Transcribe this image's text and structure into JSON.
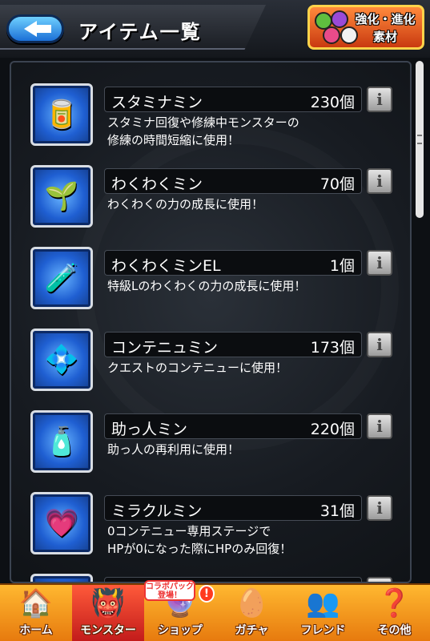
{
  "header": {
    "title": "アイテム一覧",
    "evolve_label_line1": "強化・進化",
    "evolve_label_line2": "素材"
  },
  "items": [
    {
      "name": "スタミナミン",
      "count": "230個",
      "desc1": "スタミナ回復や修練中モンスターの",
      "desc2": "修練の時間短縮に使用！",
      "icon": "stamina-can-icon"
    },
    {
      "name": "わくわくミン",
      "count": "70個",
      "desc1": "わくわくの力の成長に使用！",
      "desc2": "",
      "icon": "sprout-bottle-icon"
    },
    {
      "name": "わくわくミンEL",
      "count": "1個",
      "desc1": "特級Lのわくわくの力の成長に使用！",
      "desc2": "",
      "icon": "sprout-bottle-el-icon"
    },
    {
      "name": "コンテニュミン",
      "count": "173個",
      "desc1": "クエストのコンテニューに使用！",
      "desc2": "",
      "icon": "continue-potion-icon"
    },
    {
      "name": "助っ人ミン",
      "count": "220個",
      "desc1": "助っ人の再利用に使用！",
      "desc2": "",
      "icon": "helper-bottle-icon"
    },
    {
      "name": "ミラクルミン",
      "count": "31個",
      "desc1": "0コンテニュー専用ステージで",
      "desc2": "HPが0になった際にHPのみ回復！",
      "icon": "miracle-heart-potion-icon"
    },
    {
      "name": "",
      "count": "",
      "desc1": "",
      "desc2": "",
      "icon": "partial-item-icon"
    }
  ],
  "info_label": "i",
  "nav": {
    "home": "ホーム",
    "monster": "モンスター",
    "shop": "ショップ",
    "gacha": "ガチャ",
    "friend": "フレンド",
    "other": "その他",
    "collab_badge": "コラボパック登場！",
    "alert": "!"
  },
  "colors": {
    "nav_bg": "#f59a1c",
    "icon_bg": "#1f5fd2",
    "back_button": "#1b6fd6"
  }
}
